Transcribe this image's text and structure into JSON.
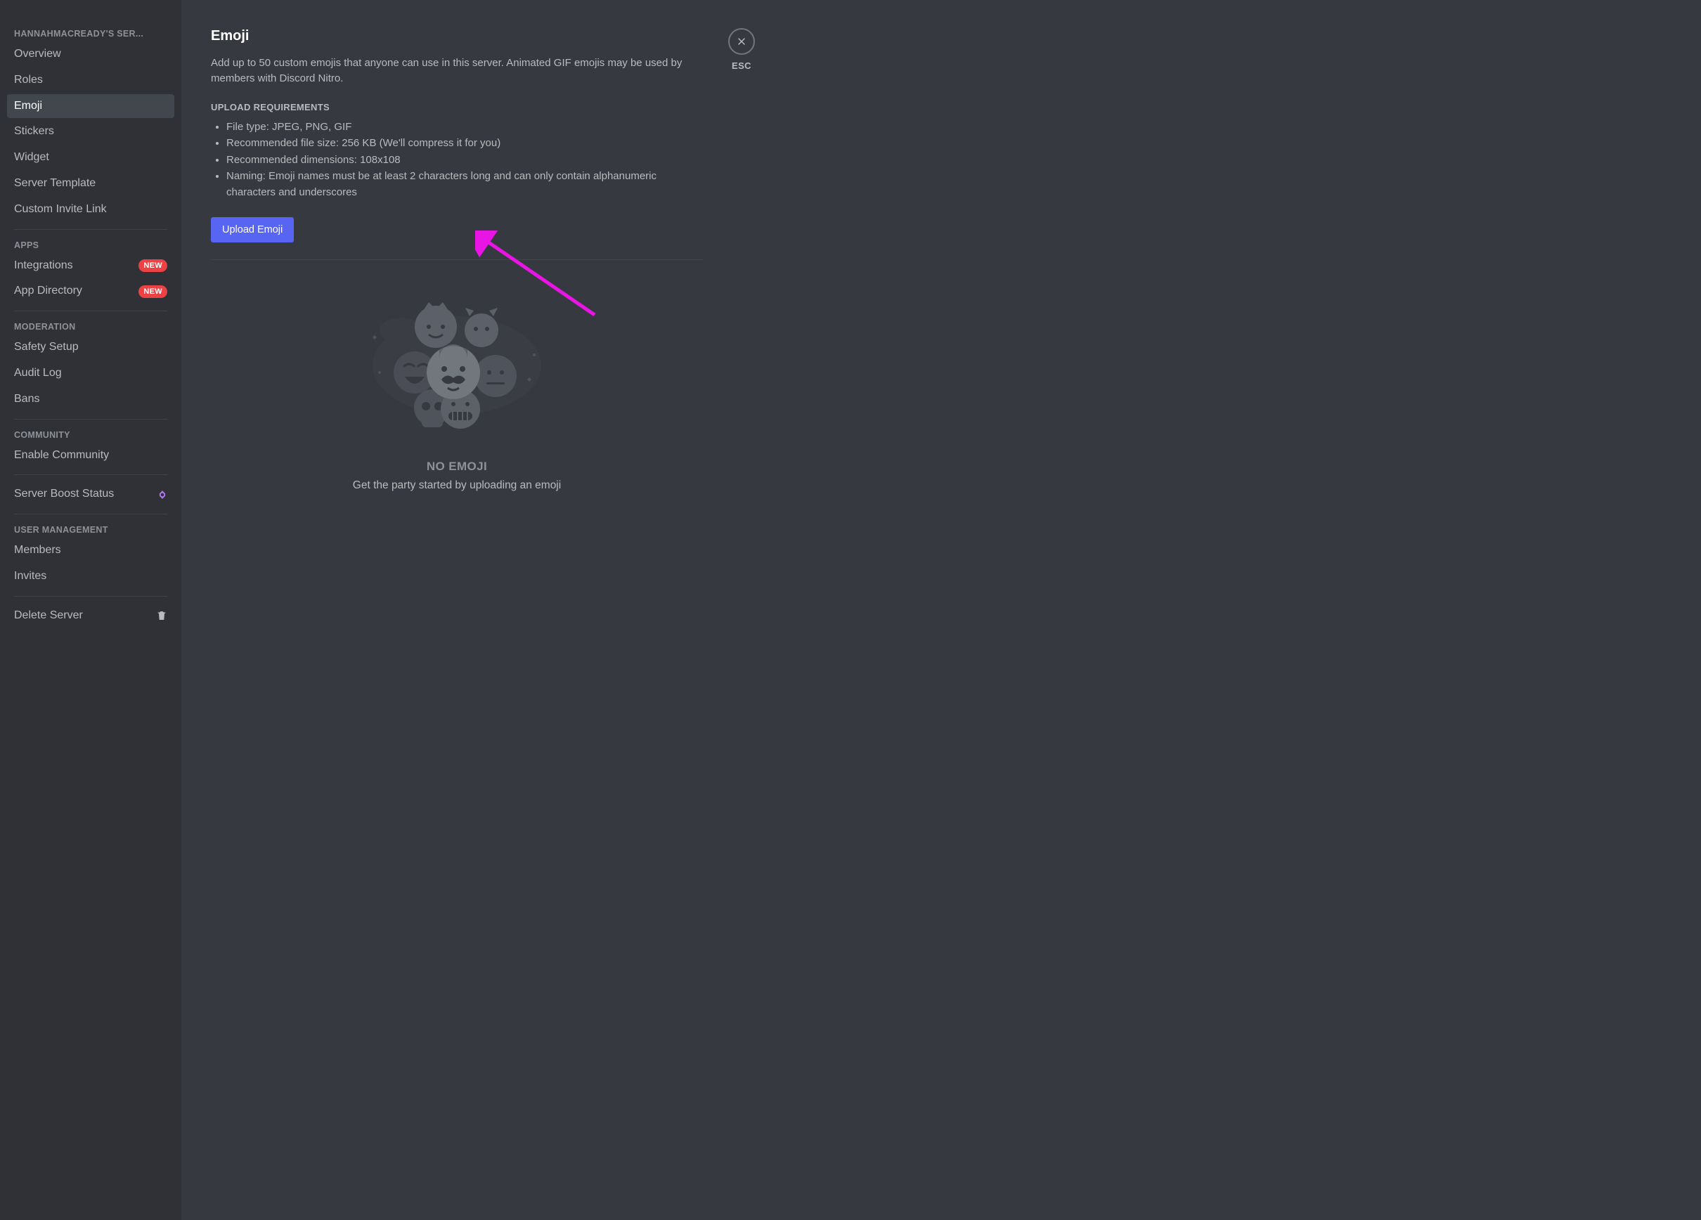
{
  "sidebar": {
    "server_heading": "HANNAHMACREADY'S SER...",
    "items_main": [
      {
        "label": "Overview"
      },
      {
        "label": "Roles"
      },
      {
        "label": "Emoji",
        "active": true
      },
      {
        "label": "Stickers"
      },
      {
        "label": "Widget"
      },
      {
        "label": "Server Template"
      },
      {
        "label": "Custom Invite Link"
      }
    ],
    "heading_apps": "APPS",
    "items_apps": [
      {
        "label": "Integrations",
        "badge": "NEW"
      },
      {
        "label": "App Directory",
        "badge": "NEW"
      }
    ],
    "heading_moderation": "MODERATION",
    "items_moderation": [
      {
        "label": "Safety Setup"
      },
      {
        "label": "Audit Log"
      },
      {
        "label": "Bans"
      }
    ],
    "heading_community": "COMMUNITY",
    "items_community": [
      {
        "label": "Enable Community"
      }
    ],
    "boost_label": "Server Boost Status",
    "heading_user_mgmt": "USER MANAGEMENT",
    "items_user_mgmt": [
      {
        "label": "Members"
      },
      {
        "label": "Invites"
      }
    ],
    "delete_label": "Delete Server"
  },
  "main": {
    "title": "Emoji",
    "description": "Add up to 50 custom emojis that anyone can use in this server. Animated GIF emojis may be used by members with Discord Nitro.",
    "req_heading": "UPLOAD REQUIREMENTS",
    "requirements": [
      "File type: JPEG, PNG, GIF",
      "Recommended file size: 256 KB (We'll compress it for you)",
      "Recommended dimensions: 108x108",
      "Naming: Emoji names must be at least 2 characters long and can only contain alphanumeric characters and underscores"
    ],
    "upload_label": "Upload Emoji",
    "empty_title": "NO EMOJI",
    "empty_sub": "Get the party started by uploading an emoji"
  },
  "close": {
    "label": "ESC"
  },
  "colors": {
    "accent": "#5865f2",
    "danger": "#ed4245",
    "annotation": "#e815e5"
  }
}
